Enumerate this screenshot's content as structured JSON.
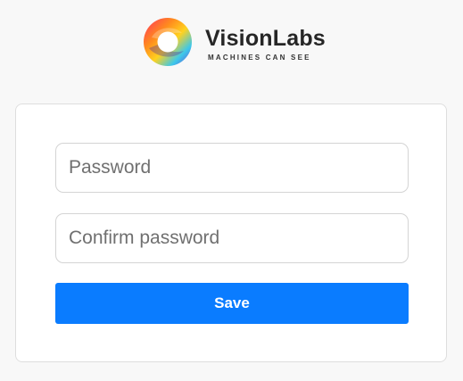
{
  "brand": {
    "name": "VisionLabs",
    "tagline": "MACHINES CAN SEE"
  },
  "form": {
    "password": {
      "value": "",
      "placeholder": "Password"
    },
    "confirm_password": {
      "value": "",
      "placeholder": "Confirm password"
    },
    "save_label": "Save"
  },
  "colors": {
    "primary": "#0a7cff",
    "background": "#f8f8f8",
    "card": "#ffffff",
    "border": "#dedede"
  }
}
